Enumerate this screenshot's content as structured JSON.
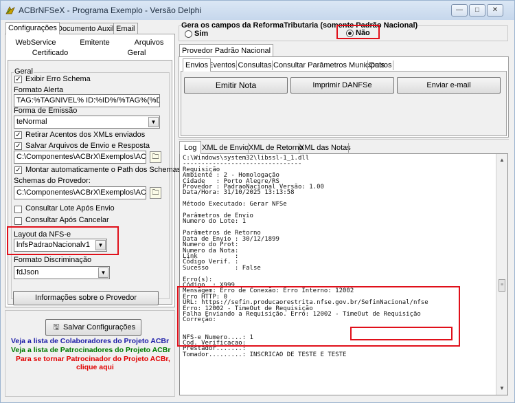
{
  "window": {
    "title": "ACBrNFSeX - Programa Exemplo - Versão Delphi",
    "controls": [
      "—",
      "□",
      "✕"
    ]
  },
  "left": {
    "tabs_top": [
      "Configurações",
      "Documento Auxiliar",
      "Email"
    ],
    "tabs_row2": [
      "WebService",
      "Emitente",
      "Arquivos"
    ],
    "tabs_row3": [
      "Certificado",
      "Geral"
    ],
    "group_title": "Geral",
    "exibir_erro": "Exibir Erro Schema",
    "formato_alerta_label": "Formato Alerta",
    "formato_alerta_value": "TAG:%TAGNIVEL% ID:%ID%/%TAG%(%DESCRI",
    "forma_emissao_label": "Forma de Emissão",
    "forma_emissao_value": "teNormal",
    "retirar_acentos": "Retirar Acentos dos XMLs enviados",
    "salvar_arquivos": "Salvar Arquivos de Envio e Resposta",
    "path1": "C:\\Componentes\\ACBrX\\Exemplos\\ACBrDFe\\A",
    "montar_path": "Montar automaticamente o Path dos Schemas",
    "schemas_label": "Schemas do Provedor:",
    "path2": "C:\\Componentes\\ACBrX\\Exemplos\\ACBrDFe\\S",
    "consultar_lote": "Consultar Lote Após Envio",
    "consultar_cancelar": "Consultar Após Cancelar",
    "layout_label": "Layout da NFS-e",
    "layout_value": "lnfsPadraoNacionalv1",
    "formato_disc_label": "Formato Discriminação",
    "formato_disc_value": "fdJson",
    "info_provedor": "Informações sobre o Provedor",
    "salvar_config": "Salvar Configurações",
    "link_colab": "Veja a lista de Colaboradores do Projeto ACBr",
    "link_patroc": "Veja a lista de Patrocinadores do Projeto ACBr",
    "link_tornar1": "Para se tornar Patrocinador do Projeto ACBr,",
    "link_tornar2": "clique aqui"
  },
  "right": {
    "reforma_title": "Gera os campos da ReformaTributaria (somente Padrão Nacional)",
    "opt_sim": "Sim",
    "opt_nao": "Não",
    "provedor_tab": "Provedor Padrão Nacional",
    "tabs": [
      "Envios",
      "Eventos",
      "Consultas",
      "Consultar Parâmetros Municipais",
      "Outros"
    ],
    "btn_emitir": "Emitir Nota",
    "btn_danfse": "Imprimir DANFSe",
    "btn_email": "Enviar e-mail",
    "log_tabs": [
      "Log",
      "XML de Envio",
      "XML de Retorno",
      "XML das Notas"
    ],
    "log_lines": [
      "C:\\Windows\\system32\\libssl-1_1.dll",
      "--------------------------------",
      "Requisição",
      "Ambiente : 2 - Homologação",
      "Cidade   : Porto Alegre/RS",
      "Provedor : PadraoNacional Versão: 1.00",
      "Data/Hora: 31/10/2025 13:13:58",
      "",
      "Método Executado: Gerar NFSe",
      "",
      "Parâmetros de Envio",
      "Numero do Lote: 1",
      "",
      "Parâmetros de Retorno",
      "Data de Envio : 30/12/1899",
      "Numero do Prot:",
      "Numero da Nota:",
      "Link          :",
      "Código Verif. :",
      "Sucesso       : False",
      "",
      "Erro(s):",
      "Código  : X999",
      "Mensagem: Erro de Conexão: Erro Interno: 12002",
      "Erro HTTP: 0",
      "URL: https://sefin.producaorestrita.nfse.gov.br/SefinNacional/nfse",
      "Erro: 12002 - TimeOut de Requisição",
      "Falha Enviando a Requisição. Erro: 12002 - TimeOut de Requisição",
      "Correção:",
      "",
      "",
      "NFS-e Numero....: 1",
      "Cod. Verificacao:",
      "Prestador.......:",
      "Tomador.........: INSCRICAO DE TESTE E TESTE"
    ]
  }
}
